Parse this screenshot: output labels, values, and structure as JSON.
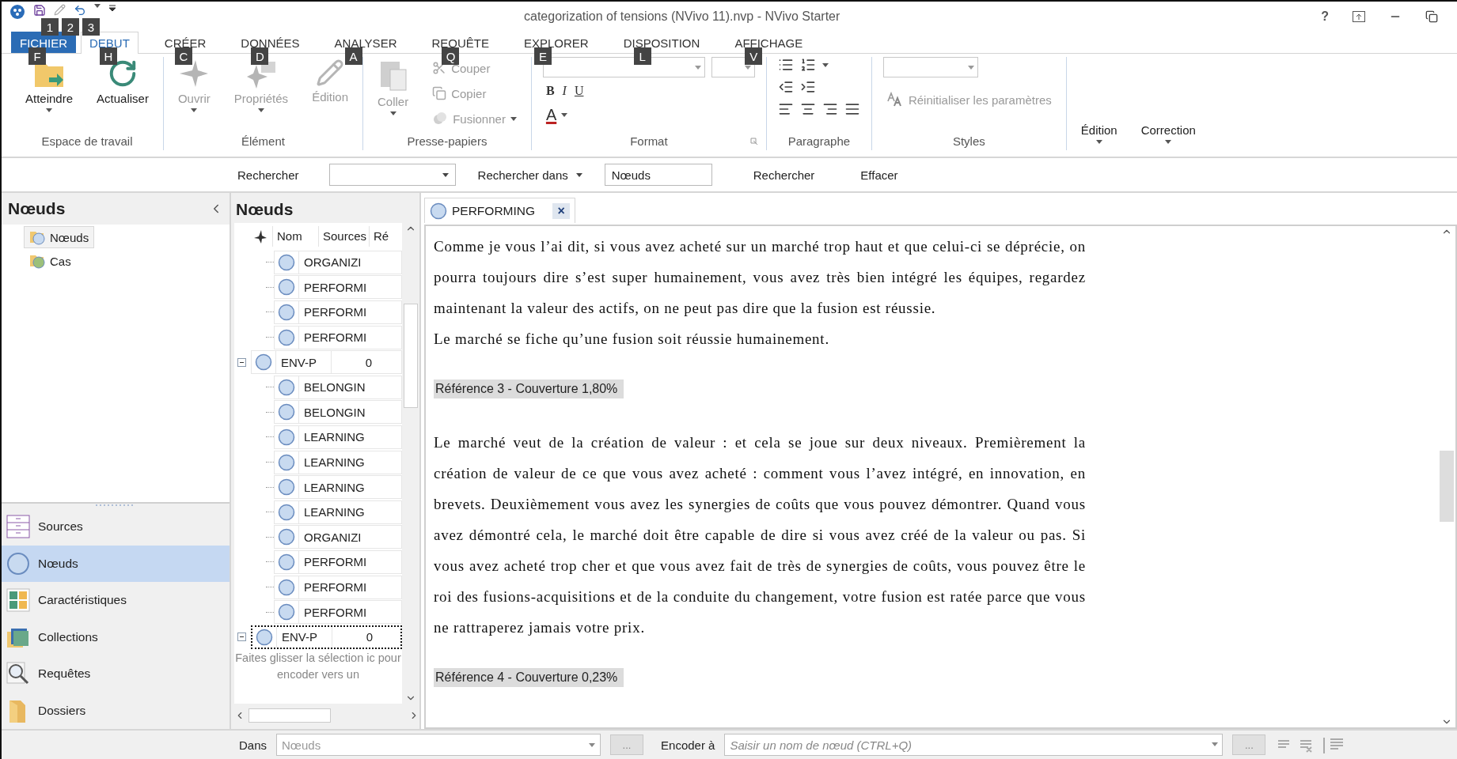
{
  "window": {
    "title": "categorization of tensions (NVivo 11).nvp - NVivo Starter",
    "help": "?"
  },
  "quick_access": {
    "keytips": [
      "1",
      "2",
      "3"
    ]
  },
  "ribbon_tabs": [
    {
      "label": "FICHIER",
      "keytip": "F",
      "selected": false,
      "kind": "file"
    },
    {
      "label": "DEBUT",
      "keytip": "H",
      "selected": true,
      "kind": "tab"
    },
    {
      "label": "CRÉER",
      "keytip": "C",
      "selected": false,
      "kind": "tab"
    },
    {
      "label": "DONNÉES",
      "keytip": "D",
      "selected": false,
      "kind": "tab"
    },
    {
      "label": "ANALYSER",
      "keytip": "A",
      "selected": false,
      "kind": "tab"
    },
    {
      "label": "REQUÊTE",
      "keytip": "Q",
      "selected": false,
      "kind": "tab"
    },
    {
      "label": "EXPLORER",
      "keytip": "E",
      "selected": false,
      "kind": "tab"
    },
    {
      "label": "DISPOSITION",
      "keytip": "L",
      "selected": false,
      "kind": "tab"
    },
    {
      "label": "AFFICHAGE",
      "keytip": "V",
      "selected": false,
      "kind": "tab"
    }
  ],
  "ribbon_groups": [
    {
      "kind": "large",
      "label": "Espace de travail",
      "buttons": [
        {
          "label": "Atteindre",
          "disabled": false,
          "dropdown": true
        },
        {
          "label": "Actualiser",
          "disabled": false,
          "dropdown": false
        }
      ]
    },
    {
      "kind": "large",
      "label": "Élément",
      "buttons": [
        {
          "label": "Ouvrir",
          "disabled": true,
          "dropdown": true
        },
        {
          "label": "Propriétés",
          "disabled": true,
          "dropdown": true
        },
        {
          "label": "Édition",
          "disabled": true,
          "dropdown": false
        }
      ]
    },
    {
      "kind": "clipboard",
      "label": "Presse-papiers",
      "buttons": [
        {
          "label": "Coller",
          "disabled": true,
          "dropdown": true
        },
        {
          "label": "Couper",
          "disabled": true,
          "dropdown": false
        },
        {
          "label": "Copier",
          "disabled": true,
          "dropdown": false
        },
        {
          "label": "Fusionner",
          "disabled": true,
          "dropdown": true
        }
      ]
    },
    {
      "kind": "format",
      "label": "Format",
      "buttons": [
        {
          "label": "B"
        },
        {
          "label": "I"
        },
        {
          "label": "U"
        },
        {
          "label": "A"
        }
      ]
    },
    {
      "kind": "paragraph",
      "label": "Paragraphe"
    },
    {
      "kind": "styles",
      "label": "Styles",
      "buttons": [
        {
          "label": "Réinitialiser les paramètres",
          "disabled": true,
          "dropdown": false
        }
      ]
    },
    {
      "kind": "large",
      "buttons": [
        {
          "label": "Édition",
          "disabled": false,
          "dropdown": true
        },
        {
          "label": "Correction",
          "disabled": false,
          "dropdown": true
        }
      ]
    }
  ],
  "search_bar": {
    "label": "Rechercher",
    "scope_label": "Rechercher dans",
    "scope_value": "Nœuds",
    "search_button": "Rechercher",
    "clear_button": "Effacer"
  },
  "navigation": {
    "title": "Nœuds",
    "tree": [
      {
        "label": "Nœuds",
        "selected": true
      },
      {
        "label": "Cas",
        "selected": false
      }
    ],
    "sections": [
      {
        "label": "Sources",
        "selected": false
      },
      {
        "label": "Nœuds",
        "selected": true
      },
      {
        "label": "Caractéristiques",
        "selected": false
      },
      {
        "label": "Collections",
        "selected": false
      },
      {
        "label": "Requêtes",
        "selected": false
      },
      {
        "label": "Dossiers",
        "selected": false
      }
    ]
  },
  "node_list": {
    "title": "Nœuds",
    "columns": [
      "Nom",
      "Sources",
      "Ré"
    ],
    "rows": [
      {
        "children": [
          {
            "name": "ORGANIZI"
          },
          {
            "name": "PERFORMI"
          },
          {
            "name": "PERFORMI"
          },
          {
            "name": "PERFORMI"
          }
        ]
      },
      {
        "name": "ENV-P",
        "sources": "0",
        "expanded": true,
        "focused": false,
        "children": [
          {
            "name": "BELONGIN"
          },
          {
            "name": "BELONGIN"
          },
          {
            "name": "LEARNING"
          },
          {
            "name": "LEARNING"
          },
          {
            "name": "LEARNING"
          },
          {
            "name": "LEARNING"
          },
          {
            "name": "ORGANIZI"
          },
          {
            "name": "PERFORMI"
          },
          {
            "name": "PERFORMI"
          },
          {
            "name": "PERFORMI"
          }
        ]
      },
      {
        "name": "ENV-P",
        "sources": "0",
        "expanded": true,
        "focused": true
      }
    ],
    "hint": [
      "Faites glisser la sélection ic",
      "pour encoder vers un"
    ]
  },
  "document": {
    "tab": "PERFORMING",
    "close": "×",
    "paragraphs": [
      {
        "kind": "text",
        "text": "Comme je vous l’ai dit, si vous avez acheté sur un marché trop haut et que celui-ci se déprécie, on pourra toujours dire s’est super humainement, vous avez très bien intégré les équipes, regardez maintenant la valeur des actifs, on ne peut pas dire que la fusion est réussie.\nLe marché se fiche qu’une fusion soit réussie humainement."
      },
      {
        "kind": "reference",
        "text": "Référence 3 - Couverture 1,80%"
      },
      {
        "kind": "text",
        "text": "Le marché veut de la création de valeur : et cela se joue sur deux niveaux. Premièrement la création de valeur de ce que vous avez acheté : comment vous l’avez intégré, en innovation, en brevets. Deuxièmement vous avez les synergies de coûts que vous pouvez démontrer. Quand vous avez démontré cela, le marché doit être capable de dire si vous avez créé de la valeur ou pas. Si vous avez acheté trop cher et que vous avez fait de très de synergies de coûts, vous pouvez être le roi des fusions-acquisitions et de la conduite du changement, votre fusion est ratée parce que vous ne rattraperez jamais votre prix."
      },
      {
        "kind": "reference",
        "text": "Référence 4 - Couverture 0,23%"
      }
    ]
  },
  "bottom_bar": {
    "in_label": "Dans",
    "in_value": "Nœuds",
    "browse": "...",
    "code_label": "Encoder à",
    "code_placeholder": "Saisir un nom de nœud (CTRL+Q)",
    "browse_code": "..."
  }
}
